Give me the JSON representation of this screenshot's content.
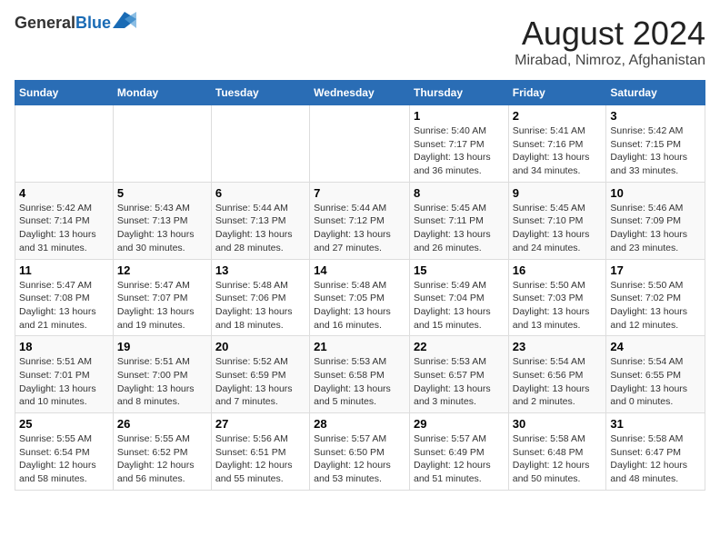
{
  "logo": {
    "line1": "General",
    "line2": "Blue"
  },
  "title": "August 2024",
  "subtitle": "Mirabad, Nimroz, Afghanistan",
  "days_of_week": [
    "Sunday",
    "Monday",
    "Tuesday",
    "Wednesday",
    "Thursday",
    "Friday",
    "Saturday"
  ],
  "weeks": [
    [
      {
        "day": "",
        "text": ""
      },
      {
        "day": "",
        "text": ""
      },
      {
        "day": "",
        "text": ""
      },
      {
        "day": "",
        "text": ""
      },
      {
        "day": "1",
        "text": "Sunrise: 5:40 AM\nSunset: 7:17 PM\nDaylight: 13 hours and 36 minutes."
      },
      {
        "day": "2",
        "text": "Sunrise: 5:41 AM\nSunset: 7:16 PM\nDaylight: 13 hours and 34 minutes."
      },
      {
        "day": "3",
        "text": "Sunrise: 5:42 AM\nSunset: 7:15 PM\nDaylight: 13 hours and 33 minutes."
      }
    ],
    [
      {
        "day": "4",
        "text": "Sunrise: 5:42 AM\nSunset: 7:14 PM\nDaylight: 13 hours and 31 minutes."
      },
      {
        "day": "5",
        "text": "Sunrise: 5:43 AM\nSunset: 7:13 PM\nDaylight: 13 hours and 30 minutes."
      },
      {
        "day": "6",
        "text": "Sunrise: 5:44 AM\nSunset: 7:13 PM\nDaylight: 13 hours and 28 minutes."
      },
      {
        "day": "7",
        "text": "Sunrise: 5:44 AM\nSunset: 7:12 PM\nDaylight: 13 hours and 27 minutes."
      },
      {
        "day": "8",
        "text": "Sunrise: 5:45 AM\nSunset: 7:11 PM\nDaylight: 13 hours and 26 minutes."
      },
      {
        "day": "9",
        "text": "Sunrise: 5:45 AM\nSunset: 7:10 PM\nDaylight: 13 hours and 24 minutes."
      },
      {
        "day": "10",
        "text": "Sunrise: 5:46 AM\nSunset: 7:09 PM\nDaylight: 13 hours and 23 minutes."
      }
    ],
    [
      {
        "day": "11",
        "text": "Sunrise: 5:47 AM\nSunset: 7:08 PM\nDaylight: 13 hours and 21 minutes."
      },
      {
        "day": "12",
        "text": "Sunrise: 5:47 AM\nSunset: 7:07 PM\nDaylight: 13 hours and 19 minutes."
      },
      {
        "day": "13",
        "text": "Sunrise: 5:48 AM\nSunset: 7:06 PM\nDaylight: 13 hours and 18 minutes."
      },
      {
        "day": "14",
        "text": "Sunrise: 5:48 AM\nSunset: 7:05 PM\nDaylight: 13 hours and 16 minutes."
      },
      {
        "day": "15",
        "text": "Sunrise: 5:49 AM\nSunset: 7:04 PM\nDaylight: 13 hours and 15 minutes."
      },
      {
        "day": "16",
        "text": "Sunrise: 5:50 AM\nSunset: 7:03 PM\nDaylight: 13 hours and 13 minutes."
      },
      {
        "day": "17",
        "text": "Sunrise: 5:50 AM\nSunset: 7:02 PM\nDaylight: 13 hours and 12 minutes."
      }
    ],
    [
      {
        "day": "18",
        "text": "Sunrise: 5:51 AM\nSunset: 7:01 PM\nDaylight: 13 hours and 10 minutes."
      },
      {
        "day": "19",
        "text": "Sunrise: 5:51 AM\nSunset: 7:00 PM\nDaylight: 13 hours and 8 minutes."
      },
      {
        "day": "20",
        "text": "Sunrise: 5:52 AM\nSunset: 6:59 PM\nDaylight: 13 hours and 7 minutes."
      },
      {
        "day": "21",
        "text": "Sunrise: 5:53 AM\nSunset: 6:58 PM\nDaylight: 13 hours and 5 minutes."
      },
      {
        "day": "22",
        "text": "Sunrise: 5:53 AM\nSunset: 6:57 PM\nDaylight: 13 hours and 3 minutes."
      },
      {
        "day": "23",
        "text": "Sunrise: 5:54 AM\nSunset: 6:56 PM\nDaylight: 13 hours and 2 minutes."
      },
      {
        "day": "24",
        "text": "Sunrise: 5:54 AM\nSunset: 6:55 PM\nDaylight: 13 hours and 0 minutes."
      }
    ],
    [
      {
        "day": "25",
        "text": "Sunrise: 5:55 AM\nSunset: 6:54 PM\nDaylight: 12 hours and 58 minutes."
      },
      {
        "day": "26",
        "text": "Sunrise: 5:55 AM\nSunset: 6:52 PM\nDaylight: 12 hours and 56 minutes."
      },
      {
        "day": "27",
        "text": "Sunrise: 5:56 AM\nSunset: 6:51 PM\nDaylight: 12 hours and 55 minutes."
      },
      {
        "day": "28",
        "text": "Sunrise: 5:57 AM\nSunset: 6:50 PM\nDaylight: 12 hours and 53 minutes."
      },
      {
        "day": "29",
        "text": "Sunrise: 5:57 AM\nSunset: 6:49 PM\nDaylight: 12 hours and 51 minutes."
      },
      {
        "day": "30",
        "text": "Sunrise: 5:58 AM\nSunset: 6:48 PM\nDaylight: 12 hours and 50 minutes."
      },
      {
        "day": "31",
        "text": "Sunrise: 5:58 AM\nSunset: 6:47 PM\nDaylight: 12 hours and 48 minutes."
      }
    ]
  ]
}
